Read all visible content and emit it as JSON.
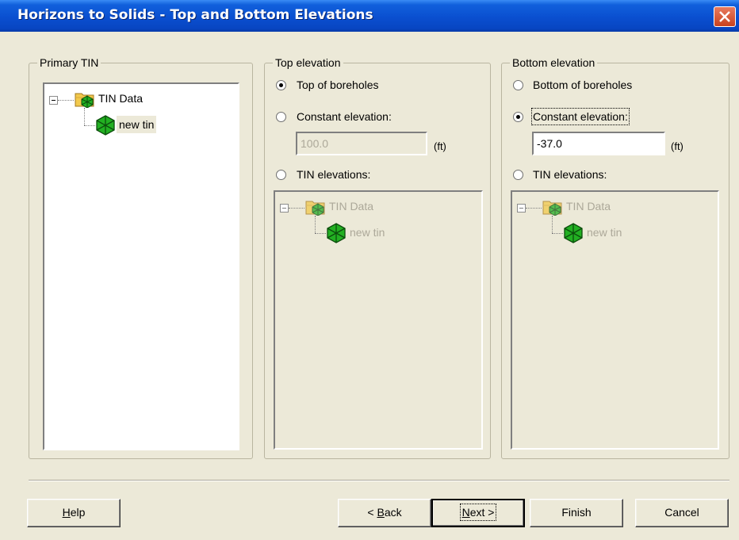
{
  "window": {
    "title": "Horizons to Solids - Top and Bottom Elevations"
  },
  "primary_tin": {
    "legend": "Primary TIN",
    "tree": {
      "root_label": "TIN Data",
      "child_label": "new tin"
    }
  },
  "top_elevation": {
    "legend": "Top elevation",
    "options": [
      {
        "label": "Top of boreholes",
        "selected": true
      },
      {
        "label": "Constant elevation:",
        "selected": false
      },
      {
        "label": "TIN elevations:",
        "selected": false
      }
    ],
    "constant_value": "100.0",
    "unit": "(ft)",
    "tree": {
      "root_label": "TIN Data",
      "child_label": "new tin"
    }
  },
  "bottom_elevation": {
    "legend": "Bottom elevation",
    "options": [
      {
        "label": "Bottom of boreholes",
        "selected": false
      },
      {
        "label": "Constant elevation:",
        "selected": true
      },
      {
        "label": "TIN elevations:",
        "selected": false
      }
    ],
    "constant_value": "-37.0",
    "unit": "(ft)",
    "tree": {
      "root_label": "TIN Data",
      "child_label": "new tin"
    }
  },
  "buttons": {
    "help": {
      "prefix": "",
      "mnemonic": "H",
      "rest": "elp"
    },
    "back": {
      "prefix": "< ",
      "mnemonic": "B",
      "rest": "ack"
    },
    "next": {
      "prefix": "",
      "mnemonic": "N",
      "rest": "ext >"
    },
    "finish": "Finish",
    "cancel": "Cancel"
  },
  "colors": {
    "title_bar": "#0a4fd0",
    "dialog_bg": "#ece9d8",
    "tin_icon": "#22aa22",
    "folder": "#f2c94c"
  }
}
